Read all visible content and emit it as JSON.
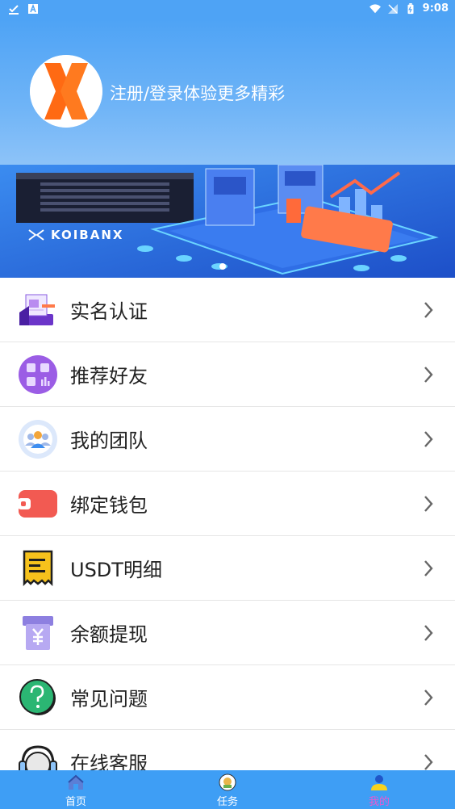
{
  "status_bar": {
    "time": "9:08"
  },
  "header": {
    "login_prompt": "注册/登录体验更多精彩"
  },
  "banner": {
    "brand": "KOIBANX",
    "slides": 3,
    "active_slide": 1
  },
  "menu": {
    "items": [
      {
        "label": "实名认证",
        "icon": "id-card-icon"
      },
      {
        "label": "推荐好友",
        "icon": "grid-apps-icon"
      },
      {
        "label": "我的团队",
        "icon": "team-icon"
      },
      {
        "label": "绑定钱包",
        "icon": "wallet-icon"
      },
      {
        "label": "USDT明细",
        "icon": "receipt-icon"
      },
      {
        "label": "余额提现",
        "icon": "yuan-withdraw-icon"
      },
      {
        "label": "常见问题",
        "icon": "question-icon"
      },
      {
        "label": "在线客服",
        "icon": "headset-icon"
      }
    ]
  },
  "bottom_nav": {
    "items": [
      {
        "label": "首页",
        "icon": "home-icon"
      },
      {
        "label": "任务",
        "icon": "task-icon"
      },
      {
        "label": "我的",
        "icon": "profile-icon",
        "active": true
      }
    ]
  },
  "colors": {
    "primary": "#4ea3f5",
    "nav_bg": "#3e9ef5",
    "active_label": "#e85ad0"
  }
}
